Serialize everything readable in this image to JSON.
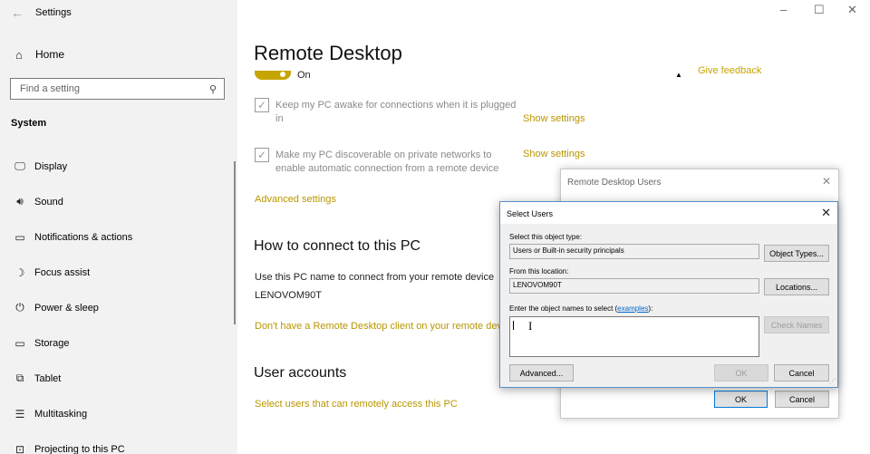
{
  "app": {
    "title": "Settings",
    "back_icon": "←"
  },
  "window": {
    "minimize": "–",
    "maximize": "☐",
    "close": "✕"
  },
  "sidebar": {
    "home_label": "Home",
    "search_placeholder": "Find a setting",
    "section": "System",
    "items": [
      {
        "label": "Display",
        "icon": "monitor-icon",
        "glyph": "🖵"
      },
      {
        "label": "Sound",
        "icon": "speaker-icon",
        "glyph": "🔊︎"
      },
      {
        "label": "Notifications & actions",
        "icon": "notification-icon",
        "glyph": "▭"
      },
      {
        "label": "Focus assist",
        "icon": "moon-icon",
        "glyph": "☽"
      },
      {
        "label": "Power & sleep",
        "icon": "power-icon",
        "glyph": "⏻"
      },
      {
        "label": "Storage",
        "icon": "storage-icon",
        "glyph": "▭"
      },
      {
        "label": "Tablet",
        "icon": "tablet-icon",
        "glyph": "⧉"
      },
      {
        "label": "Multitasking",
        "icon": "multitasking-icon",
        "glyph": "☰"
      },
      {
        "label": "Projecting to this PC",
        "icon": "projecting-icon",
        "glyph": "⊡"
      }
    ]
  },
  "main": {
    "title": "Remote Desktop",
    "toggle_state": "On",
    "feedback": "Give feedback",
    "checkbox1": "Keep my PC awake for connections when it is plugged in",
    "checkbox2": "Make my PC discoverable on private networks to enable automatic connection from a remote device",
    "show_settings": "Show settings",
    "advanced_settings": "Advanced settings",
    "connect_heading": "How to connect to this PC",
    "connect_text": "Use this PC name to connect from your remote device",
    "pc_name": "LENOVOM90T",
    "client_link": "Don't have a Remote Desktop client on your remote device?",
    "user_heading": "User accounts",
    "user_link": "Select users that can remotely access this PC"
  },
  "rdu_dialog": {
    "title": "Remote Desktop Users",
    "ok": "OK",
    "cancel": "Cancel"
  },
  "select_users": {
    "title": "Select Users",
    "object_type_label": "Select this object type:",
    "object_type_value": "Users or Built-in security principals",
    "object_types_button": "Object Types...",
    "location_label": "From this location:",
    "location_value": "LENOVOM90T",
    "locations_button": "Locations...",
    "names_label": "Enter the object names to select (",
    "examples_link": "examples",
    "names_label_end": "):",
    "names_value": "",
    "check_names_button": "Check Names",
    "advanced_button": "Advanced...",
    "ok": "OK",
    "cancel": "Cancel"
  },
  "colors": {
    "accent": "#c6a500",
    "link": "#0066cc"
  }
}
